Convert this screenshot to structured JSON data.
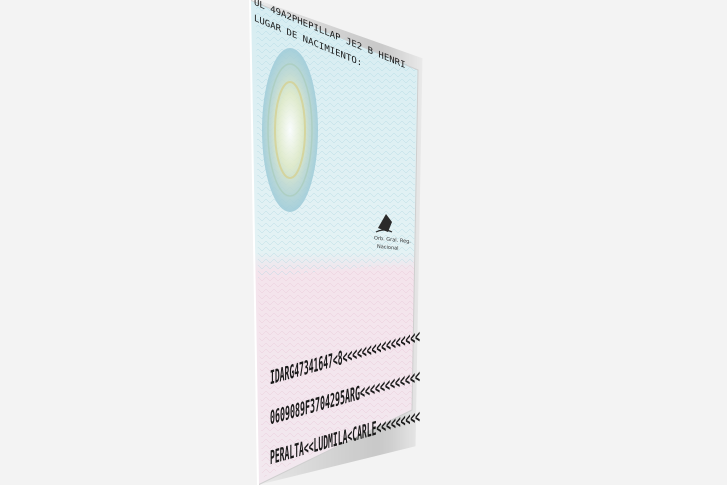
{
  "card": {
    "top_line": "UL 49A2PHEPILLAP JE2 B HENRI",
    "label_birthplace": "LUGAR DE NACIMIENTO:",
    "seal_text_1": "Orb. Gral. Reg.",
    "seal_text_2": "Nacional",
    "mrz": [
      "IDARG47341647<8<<<<<<<<<<<<<<<<",
      "0609089F3704295ARG<<<<<<<<<<<<",
      "PERALTA<<LUDMILA<CARLE<<<<<<<<<"
    ],
    "colors": {
      "background": "#f3f3f3",
      "card_top": "#d8eef2",
      "card_bottom": "#f4e1ea",
      "guilloche": "#8fc8d8",
      "sun": "#c9d7a5"
    },
    "icons": [
      "sun-emblem-icon",
      "official-seal-icon"
    ]
  }
}
